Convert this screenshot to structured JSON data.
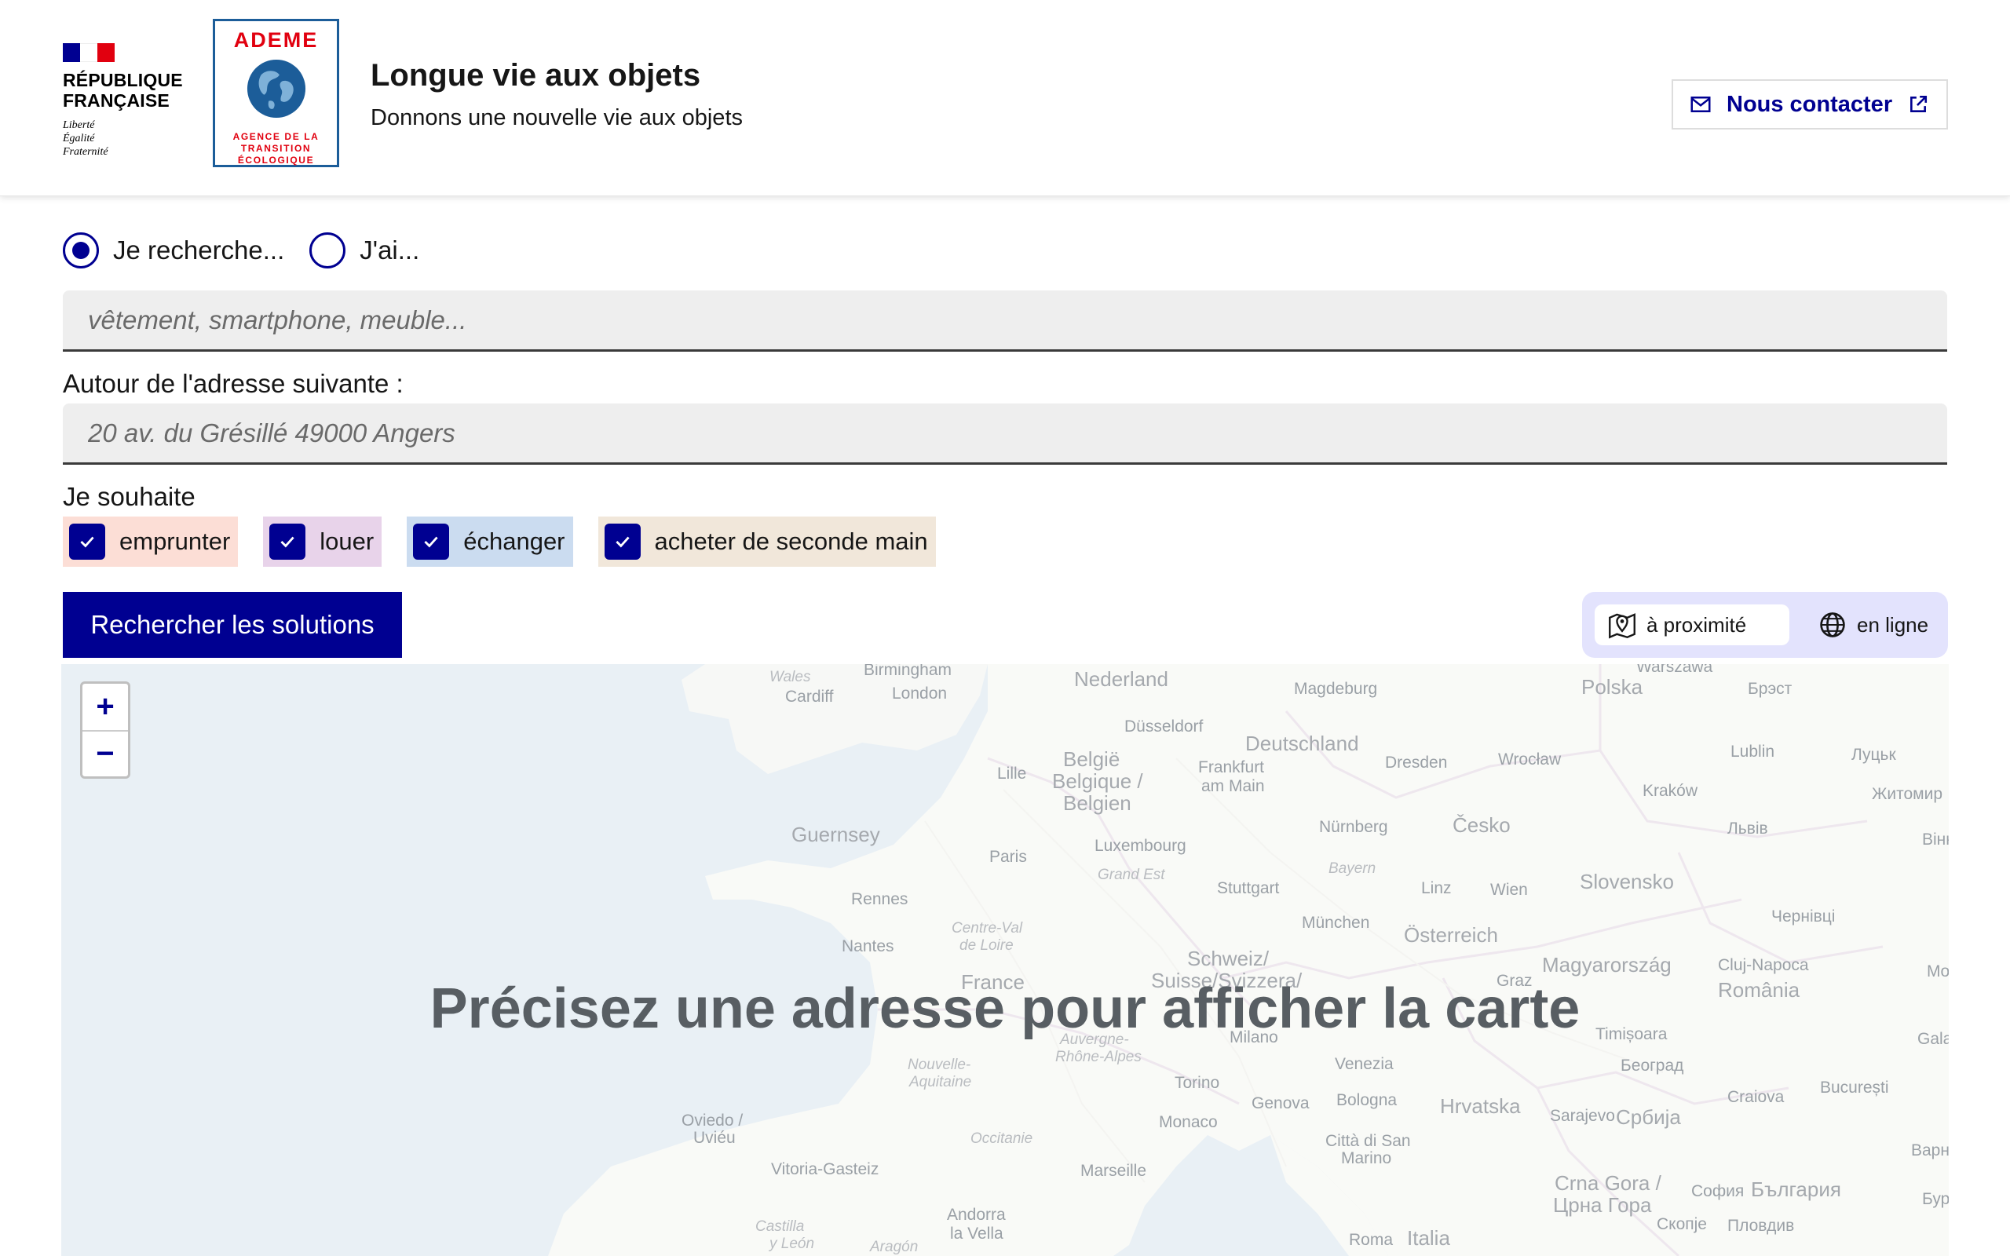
{
  "header": {
    "gov_name_line1": "RÉPUBLIQUE",
    "gov_name_line2": "FRANÇAISE",
    "motto_line1": "Liberté",
    "motto_line2": "Égalité",
    "motto_line3": "Fraternité",
    "partner_title": "ADEME",
    "partner_sub1": "AGENCE DE LA",
    "partner_sub2": "TRANSITION",
    "partner_sub3": "ÉCOLOGIQUE",
    "site_title": "Longue vie aux objets",
    "site_tagline": "Donnons une nouvelle vie aux objets",
    "contact_label": "Nous contacter"
  },
  "search": {
    "mode_options": [
      {
        "label": "Je recherche...",
        "selected": true
      },
      {
        "label": "J'ai...",
        "selected": false
      }
    ],
    "object_placeholder": "vêtement, smartphone, meuble...",
    "address_label": "Autour de l'adresse suivante :",
    "address_placeholder": "20 av. du Grésillé 49000 Angers",
    "wish_label": "Je souhaite",
    "wishes": [
      {
        "label": "emprunter",
        "checked": true,
        "color": "#fcded6"
      },
      {
        "label": "louer",
        "checked": true,
        "color": "#e8d3ea"
      },
      {
        "label": "échanger",
        "checked": true,
        "color": "#cbdcf0"
      },
      {
        "label": "acheter de seconde main",
        "checked": true,
        "color": "#f1e7da"
      }
    ],
    "submit_label": "Rechercher les solutions"
  },
  "view_toggle": {
    "nearby_label": "à proximité",
    "online_label": "en ligne",
    "active": "nearby"
  },
  "map": {
    "message": "Précisez une adresse pour afficher la carte",
    "zoom_in": "+",
    "zoom_out": "−",
    "places": [
      {
        "name": "Birmingham",
        "kind": "city"
      },
      {
        "name": "Wales",
        "kind": "region"
      },
      {
        "name": "Cardiff",
        "kind": "city"
      },
      {
        "name": "London",
        "kind": "city"
      },
      {
        "name": "Nederland",
        "kind": "country"
      },
      {
        "name": "Magdeburg",
        "kind": "city"
      },
      {
        "name": "Polska",
        "kind": "country"
      },
      {
        "name": "Warszawa",
        "kind": "city"
      },
      {
        "name": "Брэст",
        "kind": "city"
      },
      {
        "name": "Düsseldorf",
        "kind": "city"
      },
      {
        "name": "Deutschland",
        "kind": "country"
      },
      {
        "name": "België",
        "kind": "country"
      },
      {
        "name": "Belgique /",
        "kind": "country"
      },
      {
        "name": "Belgien",
        "kind": "country"
      },
      {
        "name": "Lille",
        "kind": "city"
      },
      {
        "name": "Frankfurt",
        "kind": "city"
      },
      {
        "name": "am Main",
        "kind": "city"
      },
      {
        "name": "Dresden",
        "kind": "city"
      },
      {
        "name": "Wrocław",
        "kind": "city"
      },
      {
        "name": "Lublin",
        "kind": "city"
      },
      {
        "name": "Луцьк",
        "kind": "city"
      },
      {
        "name": "Kraków",
        "kind": "city"
      },
      {
        "name": "Житомир",
        "kind": "city"
      },
      {
        "name": "Guernsey",
        "kind": "country"
      },
      {
        "name": "Luxembourg",
        "kind": "city"
      },
      {
        "name": "Nürnberg",
        "kind": "city"
      },
      {
        "name": "Česko",
        "kind": "country"
      },
      {
        "name": "Львів",
        "kind": "city"
      },
      {
        "name": "Paris",
        "kind": "city"
      },
      {
        "name": "Grand Est",
        "kind": "region"
      },
      {
        "name": "Bayern",
        "kind": "region"
      },
      {
        "name": "Stuttgart",
        "kind": "city"
      },
      {
        "name": "Linz",
        "kind": "city"
      },
      {
        "name": "Wien",
        "kind": "city"
      },
      {
        "name": "Slovensko",
        "kind": "country"
      },
      {
        "name": "Rennes",
        "kind": "city"
      },
      {
        "name": "Centre-Val",
        "kind": "region"
      },
      {
        "name": "de Loire",
        "kind": "region"
      },
      {
        "name": "München",
        "kind": "city"
      },
      {
        "name": "Österreich",
        "kind": "country"
      },
      {
        "name": "Чернівці",
        "kind": "city"
      },
      {
        "name": "Nantes",
        "kind": "city"
      },
      {
        "name": "Schweiz/",
        "kind": "country"
      },
      {
        "name": "Suisse/Svizzera/",
        "kind": "country"
      },
      {
        "name": "Magyarország",
        "kind": "country"
      },
      {
        "name": "France",
        "kind": "country"
      },
      {
        "name": "Graz",
        "kind": "city"
      },
      {
        "name": "Cluj-Napoca",
        "kind": "city"
      },
      {
        "name": "România",
        "kind": "country"
      },
      {
        "name": "Milano",
        "kind": "city"
      },
      {
        "name": "Timișoara",
        "kind": "city"
      },
      {
        "name": "Nouvelle-",
        "kind": "region"
      },
      {
        "name": "Aquitaine",
        "kind": "region"
      },
      {
        "name": "Auvergne-",
        "kind": "region"
      },
      {
        "name": "Rhône-Alpes",
        "kind": "region"
      },
      {
        "name": "Venezia",
        "kind": "city"
      },
      {
        "name": "Београд",
        "kind": "city"
      },
      {
        "name": "Torino",
        "kind": "city"
      },
      {
        "name": "Genova",
        "kind": "city"
      },
      {
        "name": "Bologna",
        "kind": "city"
      },
      {
        "name": "Hrvatska",
        "kind": "country"
      },
      {
        "name": "Craiova",
        "kind": "city"
      },
      {
        "name": "București",
        "kind": "city"
      },
      {
        "name": "Oviedo /",
        "kind": "city"
      },
      {
        "name": "Uviéu",
        "kind": "city"
      },
      {
        "name": "Monaco",
        "kind": "city"
      },
      {
        "name": "Occitanie",
        "kind": "region"
      },
      {
        "name": "Sarajevo",
        "kind": "city"
      },
      {
        "name": "Србија",
        "kind": "country"
      },
      {
        "name": "Città di San",
        "kind": "city"
      },
      {
        "name": "Marino",
        "kind": "city"
      },
      {
        "name": "Vitoria-Gasteiz",
        "kind": "city"
      },
      {
        "name": "Marseille",
        "kind": "city"
      },
      {
        "name": "Crna Gora /",
        "kind": "country"
      },
      {
        "name": "Црна Гора",
        "kind": "country"
      },
      {
        "name": "София",
        "kind": "city"
      },
      {
        "name": "България",
        "kind": "country"
      },
      {
        "name": "Andorra",
        "kind": "city"
      },
      {
        "name": "la Vella",
        "kind": "city"
      },
      {
        "name": "Castilla",
        "kind": "region"
      },
      {
        "name": "y León",
        "kind": "region"
      },
      {
        "name": "Aragón",
        "kind": "region"
      },
      {
        "name": "Roma",
        "kind": "city"
      },
      {
        "name": "Italia",
        "kind": "country"
      },
      {
        "name": "Скопје",
        "kind": "city"
      },
      {
        "name": "Пловдив",
        "kind": "city"
      },
      {
        "name": "Вінн",
        "kind": "city"
      },
      {
        "name": "Mo",
        "kind": "city"
      },
      {
        "name": "Galat",
        "kind": "city"
      },
      {
        "name": "Варна",
        "kind": "city"
      },
      {
        "name": "Бур",
        "kind": "city"
      }
    ]
  },
  "colors": {
    "primary": "#000091",
    "flag_blue": "#000091",
    "flag_white": "#ffffff",
    "flag_red": "#e1000f",
    "ademe_red": "#e1000f",
    "ademe_blue": "#1c5d99",
    "toggle_bg": "#e3e3fd"
  }
}
